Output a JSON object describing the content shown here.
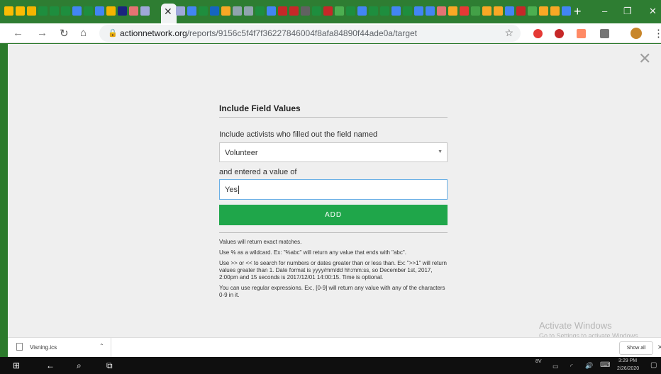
{
  "browser": {
    "url_domain": "actionnetwork.org",
    "url_path": "/reports/9156c5f4f7f36227846004f8afa84890f44ade0a/target",
    "tab_colors": [
      "#fbbc04",
      "#fbbc04",
      "#f4b400",
      "#1e8e3e",
      "#1e8e3e",
      "#1e8e3e",
      "#4285f4",
      "#1e8e3e",
      "#4285f4",
      "#f4b400",
      "#1a237e",
      "#e57373",
      "#9fa8da"
    ],
    "tab_colors_right": [
      "#9fa8da",
      "#4285f4",
      "#1e8e3e",
      "#1565c0",
      "#f9a825",
      "#90a4ae",
      "#90a4ae",
      "#1e8e3e",
      "#4285f4",
      "#c62828",
      "#c62828",
      "#616161",
      "#1e8e3e",
      "#c62828",
      "#4caf50",
      "#1e8e3e",
      "#4285f4",
      "#1e8e3e",
      "#1e8e3e",
      "#4285f4",
      "#1e8e3e",
      "#4285f4",
      "#4285f4",
      "#e57373",
      "#f9a825",
      "#e53935",
      "#43a047",
      "#f9a825",
      "#f9a825",
      "#4285f4",
      "#c62828",
      "#4caf50",
      "#f9a825",
      "#f9a825",
      "#4285f4"
    ]
  },
  "modal": {
    "title": "Include Field Values",
    "field_label": "Include activists who filled out the field named",
    "field_value": "Volunteer",
    "value_label": "and entered a value of",
    "value_input": "Yes",
    "add_button": "ADD",
    "help": [
      "Values will return exact matches.",
      "Use % as a wildcard. Ex: \"%abc\" will return any value that ends with \"abc\".",
      "Use >> or << to search for numbers or dates greater than or less than. Ex: \">>1\" will return values greater than 1. Date format is yyyy/mm/dd hh:mm:ss, so December 1st, 2017, 2:00pm and 15 seconds is 2017/12/01 14:00:15. Time is optional.",
      "You can use regular expressions. Ex:, [0-9] will return any value with any of the characters 0-9 in it."
    ]
  },
  "watermark": {
    "line1": "Activate Windows",
    "line2": "Go to Settings to activate Windows."
  },
  "downloads": {
    "file": "Visning.ics",
    "show_all": "Show all"
  },
  "taskbar": {
    "time": "3:29 PM",
    "date": "2/26/2020",
    "weather": "8V"
  }
}
